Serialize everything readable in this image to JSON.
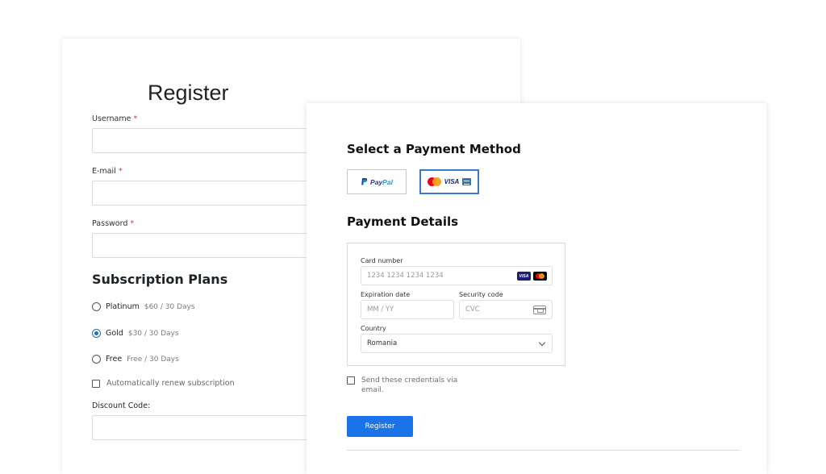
{
  "register": {
    "title": "Register",
    "username_label": "Username",
    "email_label": "E-mail",
    "password_label": "Password",
    "required_mark": "*",
    "username_value": "",
    "email_value": "",
    "password_value": ""
  },
  "subscription": {
    "title": "Subscription Plans",
    "plans": [
      {
        "name": "Platinum",
        "price": "$60 / 30 Days",
        "selected": false
      },
      {
        "name": "Gold",
        "price": "$30 / 30 Days",
        "selected": true
      },
      {
        "name": "Free",
        "price": "Free / 30 Days",
        "selected": false
      }
    ],
    "auto_renew_label": "Automatically renew subscription",
    "auto_renew_checked": false,
    "discount_label": "Discount Code:",
    "discount_value": ""
  },
  "payment": {
    "method_title": "Select a Payment Method",
    "methods": [
      {
        "name": "PayPal",
        "icon": "paypal-logo",
        "selected": false
      },
      {
        "name": "VISA",
        "icon": "card-logos",
        "selected": true
      }
    ],
    "paypal_text_1": "Pay",
    "paypal_text_2": "Pal",
    "visa_text": "VISA",
    "details_title": "Payment Details",
    "card_number_label": "Card number",
    "card_number_placeholder": "1234 1234 1234 1234",
    "card_icon_visa_text": "VISA",
    "expiration_label": "Expiration date",
    "expiration_placeholder": "MM / YY",
    "security_label": "Security code",
    "security_placeholder": "CVC",
    "country_label": "Country",
    "country_value": "Romania",
    "send_credentials_label": "Send these credentials via email.",
    "send_credentials_checked": false,
    "register_button": "Register"
  },
  "colors": {
    "accent": "#1a73e8",
    "radio_checked": "#2271b1",
    "required": "#d63638",
    "selected_method_border": "#3a78c9"
  }
}
